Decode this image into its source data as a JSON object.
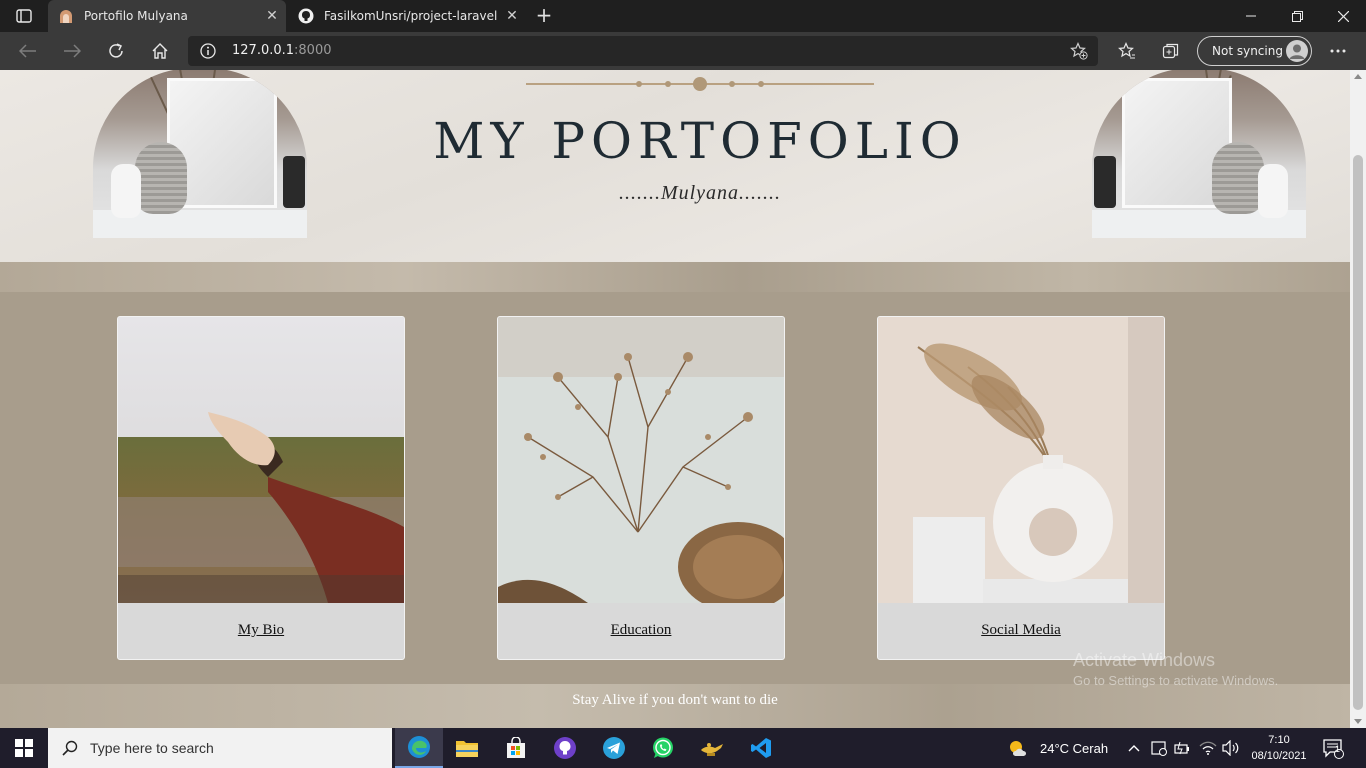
{
  "browser": {
    "tabs": [
      {
        "title": "Portofilo Mulyana",
        "active": true
      },
      {
        "title": "FasilkomUnsri/project-laravel",
        "active": false
      }
    ],
    "url_host": "127.0.0.1",
    "url_port": ":8000",
    "sync_label": "Not syncing"
  },
  "page": {
    "title": "MY PORTOFOLIO",
    "subtitle": ".......Mulyana.......",
    "cards": [
      {
        "label": "My Bio"
      },
      {
        "label": "Education"
      },
      {
        "label": "Social Media"
      }
    ],
    "footer": "Stay Alive if you don't want to die"
  },
  "watermark": {
    "line1": "Activate Windows",
    "line2": "Go to Settings to activate Windows."
  },
  "taskbar": {
    "search_placeholder": "Type here to search",
    "weather": "24°C  Cerah",
    "time": "7:10",
    "date": "08/10/2021",
    "notification_count": "1"
  },
  "colors": {
    "page_bg": "#a89d8c",
    "title_color": "#1f2b33",
    "ornament": "#b09878"
  }
}
